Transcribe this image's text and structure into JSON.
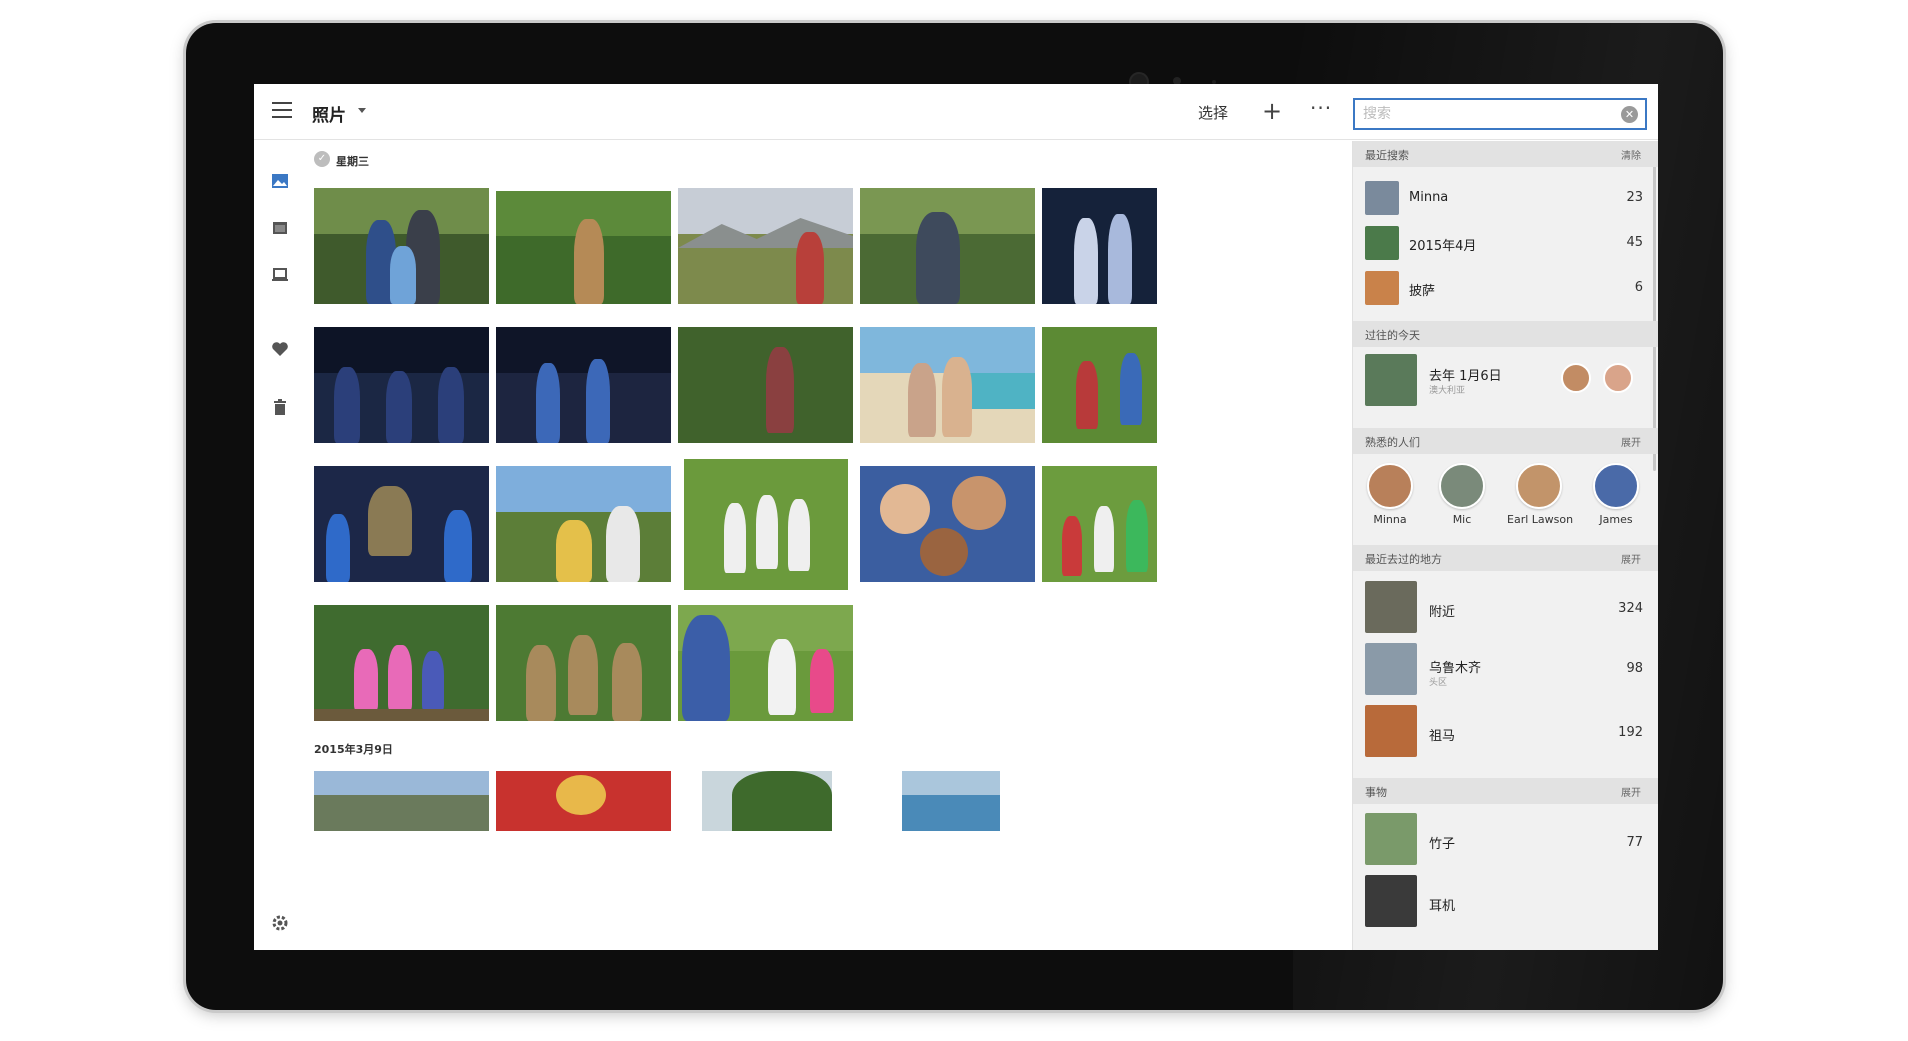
{
  "app": {
    "title": "照片",
    "select_label": "选择",
    "plus_glyph": "+",
    "more_glyph": "···"
  },
  "search": {
    "placeholder": "搜索",
    "value": ""
  },
  "rail": {
    "icons": [
      "photos-icon",
      "albums-icon",
      "device-icon",
      "favorites-icon",
      "trash-icon",
      "settings-icon"
    ]
  },
  "content": {
    "group1_label": "星期三",
    "group2_label": "2015年3月9日"
  },
  "panel": {
    "recent": {
      "header": "最近搜索",
      "action": "清除",
      "items": [
        {
          "label": "Minna",
          "count": "23"
        },
        {
          "label": "2015年4月",
          "count": "45"
        },
        {
          "label": "披萨",
          "count": "6"
        }
      ]
    },
    "on_this_day": {
      "header": "过往的今天",
      "label": "去年 1月6日",
      "sub": "澳大利亚"
    },
    "people": {
      "header": "熟悉的人们",
      "action": "展开",
      "items": [
        {
          "name": "Minna"
        },
        {
          "name": "Mic"
        },
        {
          "name": "Earl Lawson"
        },
        {
          "name": "James"
        }
      ]
    },
    "places": {
      "header": "最近去过的地方",
      "action": "展开",
      "items": [
        {
          "label": "附近",
          "sub": "",
          "count": "324"
        },
        {
          "label": "乌鲁木齐",
          "sub": "头区",
          "count": "98"
        },
        {
          "label": "祖马",
          "sub": "",
          "count": "192"
        }
      ]
    },
    "things": {
      "header": "事物",
      "action": "展开",
      "items": [
        {
          "label": "竹子",
          "count": "77"
        },
        {
          "label": "耳机",
          "count": ""
        }
      ]
    }
  },
  "colors": {
    "accent": "#3b78c4",
    "panel_bg": "#f1f1f1",
    "section_bg": "#e2e2e2"
  }
}
